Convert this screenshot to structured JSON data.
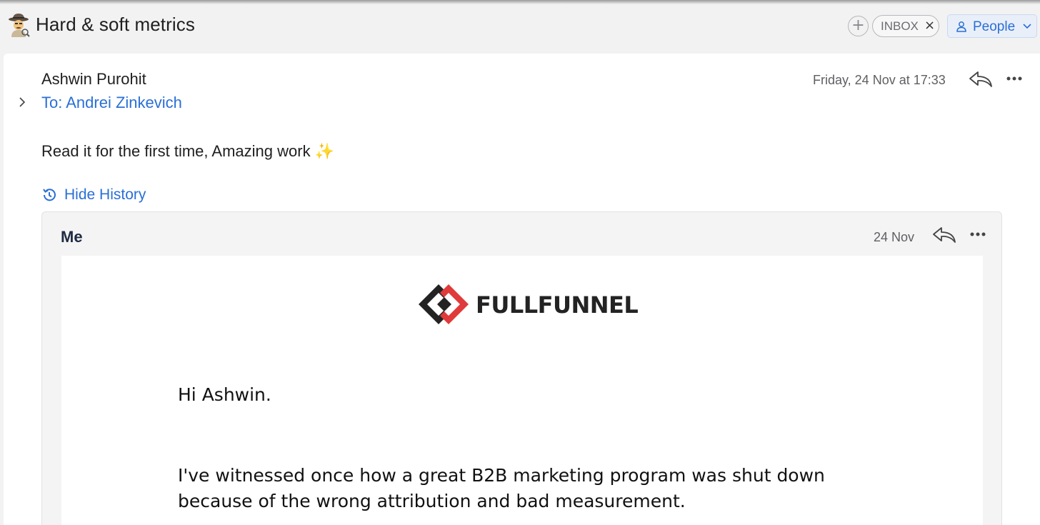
{
  "thread": {
    "subject": "Hard & soft metrics",
    "subject_icon": "detective-emoji-icon",
    "label_chip": "INBOX",
    "label_remove": "×",
    "add_label": "+",
    "people_button": "People"
  },
  "message": {
    "sender": "Ashwin Purohit",
    "recipients": "To: Andrei Zinkevich",
    "date": "Friday, 24 Nov at 17:33",
    "body": "Read it for the first time, Amazing work",
    "body_emoji": "✨",
    "history_toggle": "Hide History"
  },
  "quoted": {
    "sender": "Me",
    "date": "24 Nov",
    "logo_text": "FULLFUNNEL",
    "greeting": "Hi Ashwin.",
    "paragraph": "I've witnessed once how a great B2B marketing program was shut down because of the wrong attribution and bad measurement."
  },
  "colors": {
    "accent": "#2a6fd6",
    "logo_red": "#e03a3a",
    "logo_dark": "#232323"
  }
}
